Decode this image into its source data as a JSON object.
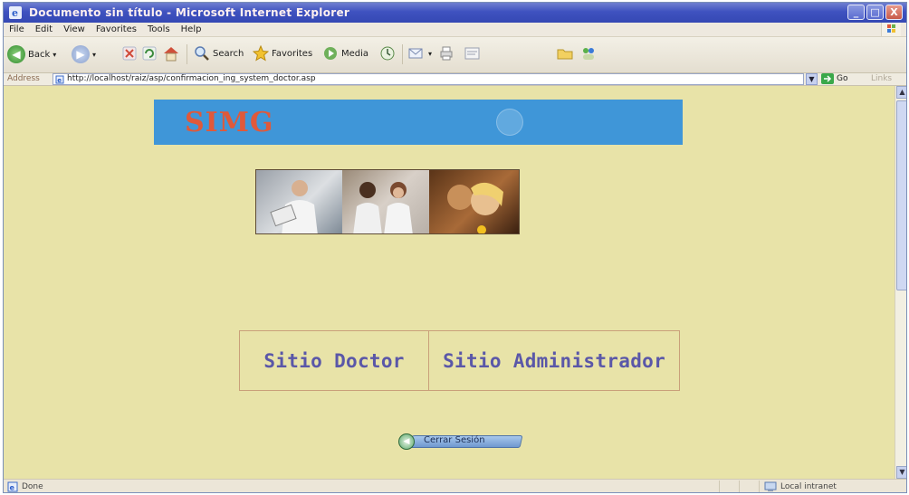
{
  "window": {
    "title": "Documento sin título - Microsoft Internet Explorer",
    "controls": {
      "minimize": "_",
      "maximize": "□",
      "close": "X"
    }
  },
  "menu": [
    "File",
    "Edit",
    "View",
    "Favorites",
    "Tools",
    "Help"
  ],
  "toolbar": {
    "back_label": "Back",
    "search_label": "Search",
    "favorites_label": "Favorites",
    "media_label": "Media"
  },
  "address": {
    "label": "Address",
    "url": "http://localhost/raiz/asp/confirmacion_ing_system_doctor.asp",
    "go_label": "Go",
    "links_label": "Links"
  },
  "page": {
    "brand": "SIMG",
    "site_doctor": "Sitio Doctor",
    "site_admin": "Sitio Administrador",
    "logout_label": "Cerrar Sesión"
  },
  "status": {
    "text": "Done",
    "zone": "Local intranet"
  },
  "colors": {
    "page_background": "#e8e3a8",
    "banner": "#3f96d8",
    "brand_text": "#e0593a",
    "site_button_text": "#5a57a8"
  },
  "icons": [
    "ie-icon",
    "back-arrow-icon",
    "forward-arrow-icon",
    "stop-icon",
    "refresh-icon",
    "home-icon",
    "search-icon",
    "favorites-star-icon",
    "media-icon",
    "history-icon",
    "mail-icon",
    "print-icon",
    "edit-icon",
    "folder-icon",
    "messenger-icon",
    "go-arrow-icon",
    "page-icon",
    "intranet-icon",
    "logout-arrow-icon"
  ]
}
